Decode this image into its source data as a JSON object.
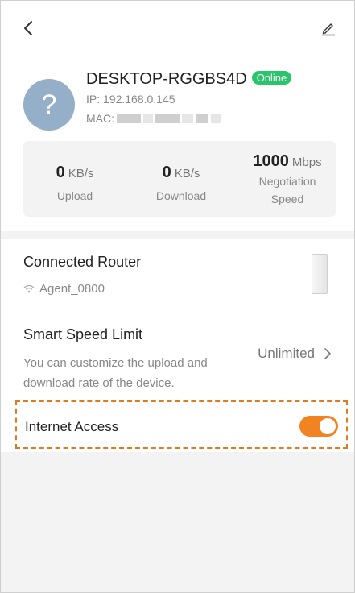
{
  "device": {
    "name": "DESKTOP-RGGBS4D",
    "status": "Online",
    "ip": "IP: 192.168.0.145",
    "mac_label": "MAC:"
  },
  "stats": {
    "upload": {
      "value": "0",
      "unit": "KB/s",
      "label": "Upload"
    },
    "download": {
      "value": "0",
      "unit": "KB/s",
      "label": "Download"
    },
    "negotiation": {
      "value": "1000",
      "unit": "Mbps",
      "label_line1": "Negotiation",
      "label_line2": "Speed"
    }
  },
  "connected_router": {
    "title": "Connected Router",
    "ssid": "Agent_0800"
  },
  "speed_limit": {
    "title": "Smart Speed Limit",
    "description": "You can customize the upload and download rate of the device.",
    "value": "Unlimited"
  },
  "internet_access": {
    "label": "Internet Access",
    "enabled": true
  },
  "colors": {
    "accent": "#f28322",
    "online": "#2bc46c",
    "highlight_border": "#e07a1a",
    "avatar": "#95afc9"
  },
  "icons": [
    "back-icon",
    "edit-icon",
    "question-icon",
    "wifi-icon",
    "chevron-right-icon"
  ]
}
